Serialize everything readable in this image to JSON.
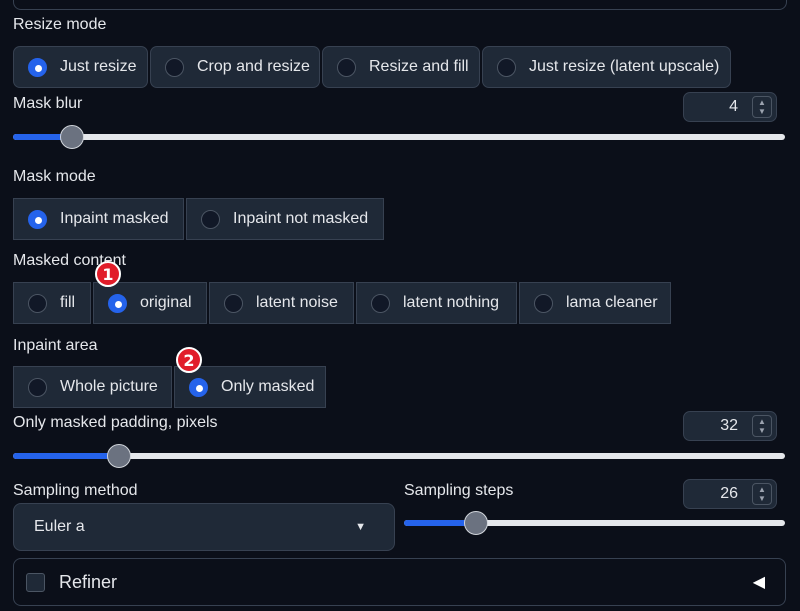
{
  "resize_mode": {
    "label": "Resize mode",
    "options": [
      "Just resize",
      "Crop and resize",
      "Resize and fill",
      "Just resize (latent upscale)"
    ],
    "selected": 0
  },
  "mask_blur": {
    "label": "Mask blur",
    "value": "4",
    "slider_fraction": 0.076
  },
  "mask_mode": {
    "label": "Mask mode",
    "options": [
      "Inpaint masked",
      "Inpaint not masked"
    ],
    "selected": 0
  },
  "masked_content": {
    "label": "Masked content",
    "options": [
      "fill",
      "original",
      "latent noise",
      "latent nothing",
      "lama cleaner"
    ],
    "selected": 1,
    "badge": "1"
  },
  "inpaint_area": {
    "label": "Inpaint area",
    "options": [
      "Whole picture",
      "Only masked"
    ],
    "selected": 1,
    "badge": "2"
  },
  "padding": {
    "label": "Only masked padding, pixels",
    "value": "32",
    "slider_fraction": 0.137
  },
  "sampling_method": {
    "label": "Sampling method",
    "value": "Euler a"
  },
  "sampling_steps": {
    "label": "Sampling steps",
    "value": "26",
    "slider_fraction": 0.19
  },
  "refiner": {
    "label": "Refiner"
  },
  "colors": {
    "accent": "#2563eb",
    "badge": "#e11d2a",
    "bg": "#0b0f19",
    "panel": "#1f2937"
  }
}
